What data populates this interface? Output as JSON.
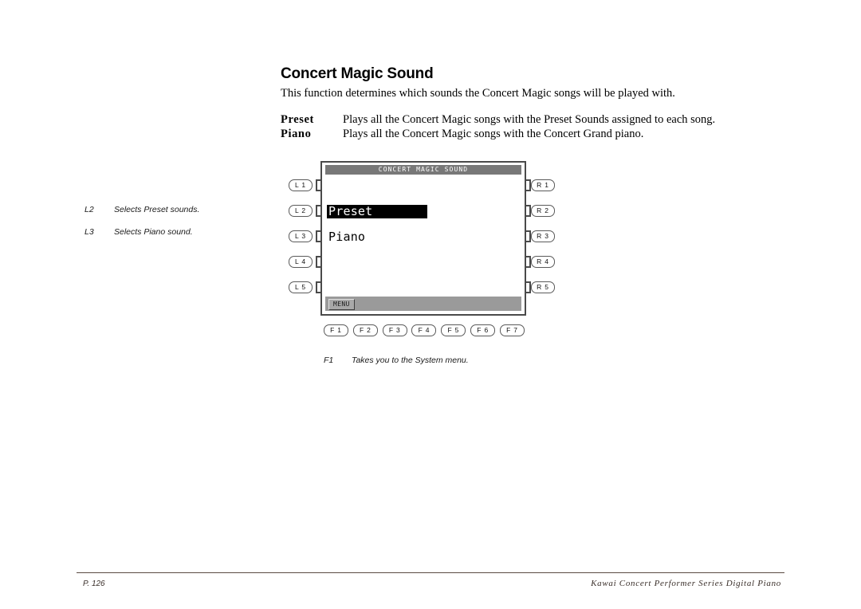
{
  "page": {
    "title": "Concert Magic Sound",
    "intro": "This function determines which sounds the Concert Magic songs will be played with.",
    "options": [
      {
        "term": "Preset",
        "desc": "Plays all the Concert Magic songs with the Preset Sounds assigned to each song."
      },
      {
        "term": "Piano",
        "desc": "Plays all the Concert Magic songs with the Concert Grand piano."
      }
    ]
  },
  "annotations": {
    "left": [
      {
        "key": "L2",
        "text": "Selects Preset sounds."
      },
      {
        "key": "L3",
        "text": "Selects Piano sound."
      }
    ],
    "bottom": {
      "key": "F1",
      "text": "Takes you to the System menu."
    }
  },
  "device": {
    "lcd": {
      "title": "CONCERT MAGIC SOUND",
      "options": [
        {
          "label": "Preset",
          "selected": true
        },
        {
          "label": "Piano",
          "selected": false
        }
      ],
      "softkey": "MENU"
    },
    "left_buttons": [
      {
        "label": "L 1"
      },
      {
        "label": "L 2"
      },
      {
        "label": "L 3"
      },
      {
        "label": "L 4"
      },
      {
        "label": "L 5"
      }
    ],
    "right_buttons": [
      {
        "label": "R 1"
      },
      {
        "label": "R 2"
      },
      {
        "label": "R 3"
      },
      {
        "label": "R 4"
      },
      {
        "label": "R 5"
      }
    ],
    "function_buttons": [
      {
        "label": "F 1"
      },
      {
        "label": "F 2"
      },
      {
        "label": "F 3"
      },
      {
        "label": "F 4"
      },
      {
        "label": "F 5"
      },
      {
        "label": "F 6"
      },
      {
        "label": "F 7"
      }
    ]
  },
  "footer": {
    "page_number": "P. 126",
    "product": "Kawai Concert Performer Series Digital Piano"
  }
}
